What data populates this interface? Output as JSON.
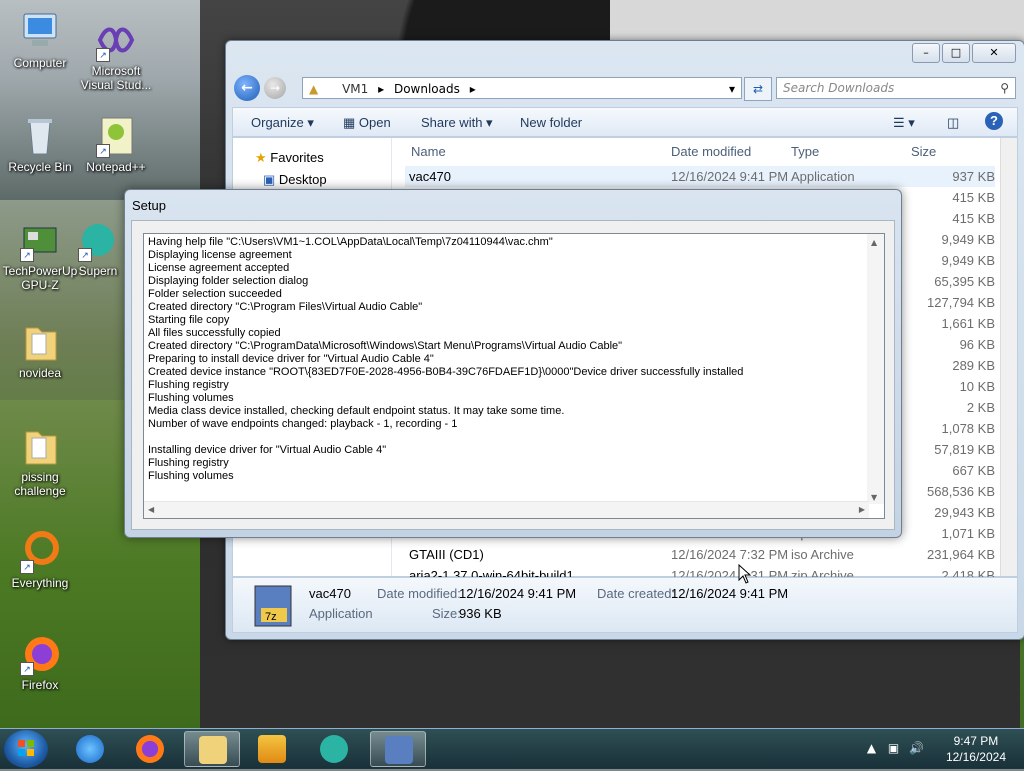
{
  "desktop": {
    "icons": [
      {
        "label": "Computer"
      },
      {
        "label": "Microsoft Visual Stud..."
      },
      {
        "label": "Recycle Bin"
      },
      {
        "label": "Notepad++"
      },
      {
        "label": "TechPowerUp GPU-Z"
      },
      {
        "label": "Supern"
      },
      {
        "label": "novidea"
      },
      {
        "label": "pissing challenge"
      },
      {
        "label": "Everything"
      },
      {
        "label": "Firefox"
      }
    ]
  },
  "explorer": {
    "breadcrumb": [
      "VM1",
      "Downloads"
    ],
    "search_placeholder": "Search Downloads",
    "toolbar": {
      "organize": "Organize",
      "open": "Open",
      "share_with": "Share with",
      "new_folder": "New folder"
    },
    "nav": {
      "favorites": "Favorites",
      "desktop": "Desktop"
    },
    "columns": {
      "name": "Name",
      "date": "Date modified",
      "type": "Type",
      "size": "Size"
    },
    "rows": [
      {
        "name": "vac470",
        "date": "12/16/2024 9:41 PM",
        "type": "Application",
        "size": "937 KB"
      },
      {
        "name": "",
        "date": "",
        "type": "",
        "size": "415 KB"
      },
      {
        "name": "",
        "date": "",
        "type": "",
        "size": "415 KB"
      },
      {
        "name": "",
        "date": "",
        "type": "",
        "size": "9,949 KB"
      },
      {
        "name": "",
        "date": "",
        "type": "",
        "size": "9,949 KB"
      },
      {
        "name": "",
        "date": "",
        "type": "",
        "size": "65,395 KB"
      },
      {
        "name": "",
        "date": "",
        "type": "",
        "size": "127,794 KB"
      },
      {
        "name": "",
        "date": "",
        "type": "",
        "size": "1,661 KB"
      },
      {
        "name": "",
        "date": "",
        "type": "",
        "size": "96 KB"
      },
      {
        "name": "",
        "date": "",
        "type": "",
        "size": "289 KB"
      },
      {
        "name": "",
        "date": "",
        "type": "",
        "size": "10 KB"
      },
      {
        "name": "",
        "date": "",
        "type": "",
        "size": "2 KB"
      },
      {
        "name": "",
        "date": "",
        "type": "",
        "size": "1,078 KB"
      },
      {
        "name": "",
        "date": "",
        "type": "",
        "size": "57,819 KB"
      },
      {
        "name": "",
        "date": "",
        "type": "",
        "size": "667 KB"
      },
      {
        "name": "",
        "date": "",
        "type": "",
        "size": "568,536 KB"
      },
      {
        "name": "",
        "date": "",
        "type": "",
        "size": "29,943 KB"
      },
      {
        "name": "GTA5.Widescreen.fix",
        "date": "12/16/2024 7:38 PM",
        "type": "zip Archive",
        "size": "1,071 KB"
      },
      {
        "name": "GTAIII (CD1)",
        "date": "12/16/2024 7:32 PM",
        "type": "iso Archive",
        "size": "231,964 KB"
      },
      {
        "name": "aria2-1.37.0-win-64bit-build1",
        "date": "12/16/2024 7:31 PM",
        "type": "zip Archive",
        "size": "2,418 KB"
      }
    ],
    "details": {
      "name": "vac470",
      "kind": "Application",
      "date_modified_label": "Date modified:",
      "date_modified": "12/16/2024 9:41 PM",
      "date_created_label": "Date created:",
      "date_created": "12/16/2024 9:41 PM",
      "size_label": "Size:",
      "size": "936 KB"
    }
  },
  "setup": {
    "title": "Setup",
    "log": [
      "Having help file \"C:\\Users\\VM1~1.COL\\AppData\\Local\\Temp\\7z04110944\\vac.chm\"",
      "Displaying license agreement",
      "License agreement accepted",
      "Displaying folder selection dialog",
      "Folder selection succeeded",
      "Created directory \"C:\\Program Files\\Virtual Audio Cable\"",
      "Starting file copy",
      "All files successfully copied",
      "Created directory \"C:\\ProgramData\\Microsoft\\Windows\\Start Menu\\Programs\\Virtual Audio Cable\"",
      "Preparing to install device driver for \"Virtual Audio Cable 4\"",
      "Created device instance \"ROOT\\{83ED7F0E-2028-4956-B0B4-39C76FDAEF1D}\\0000\"Device driver successfully installed",
      "Flushing registry",
      "Flushing volumes",
      "Media class device installed, checking default endpoint status. It may take some time.",
      "Number of wave endpoints changed: playback - 1, recording - 1",
      "",
      "Installing device driver for \"Virtual Audio Cable 4\"",
      "Flushing registry",
      "Flushing volumes"
    ]
  },
  "taskbar": {
    "time": "9:47 PM",
    "date": "12/16/2024"
  },
  "colors": {
    "accent": "#1d5fb3",
    "selection": "#e8f2fd"
  }
}
